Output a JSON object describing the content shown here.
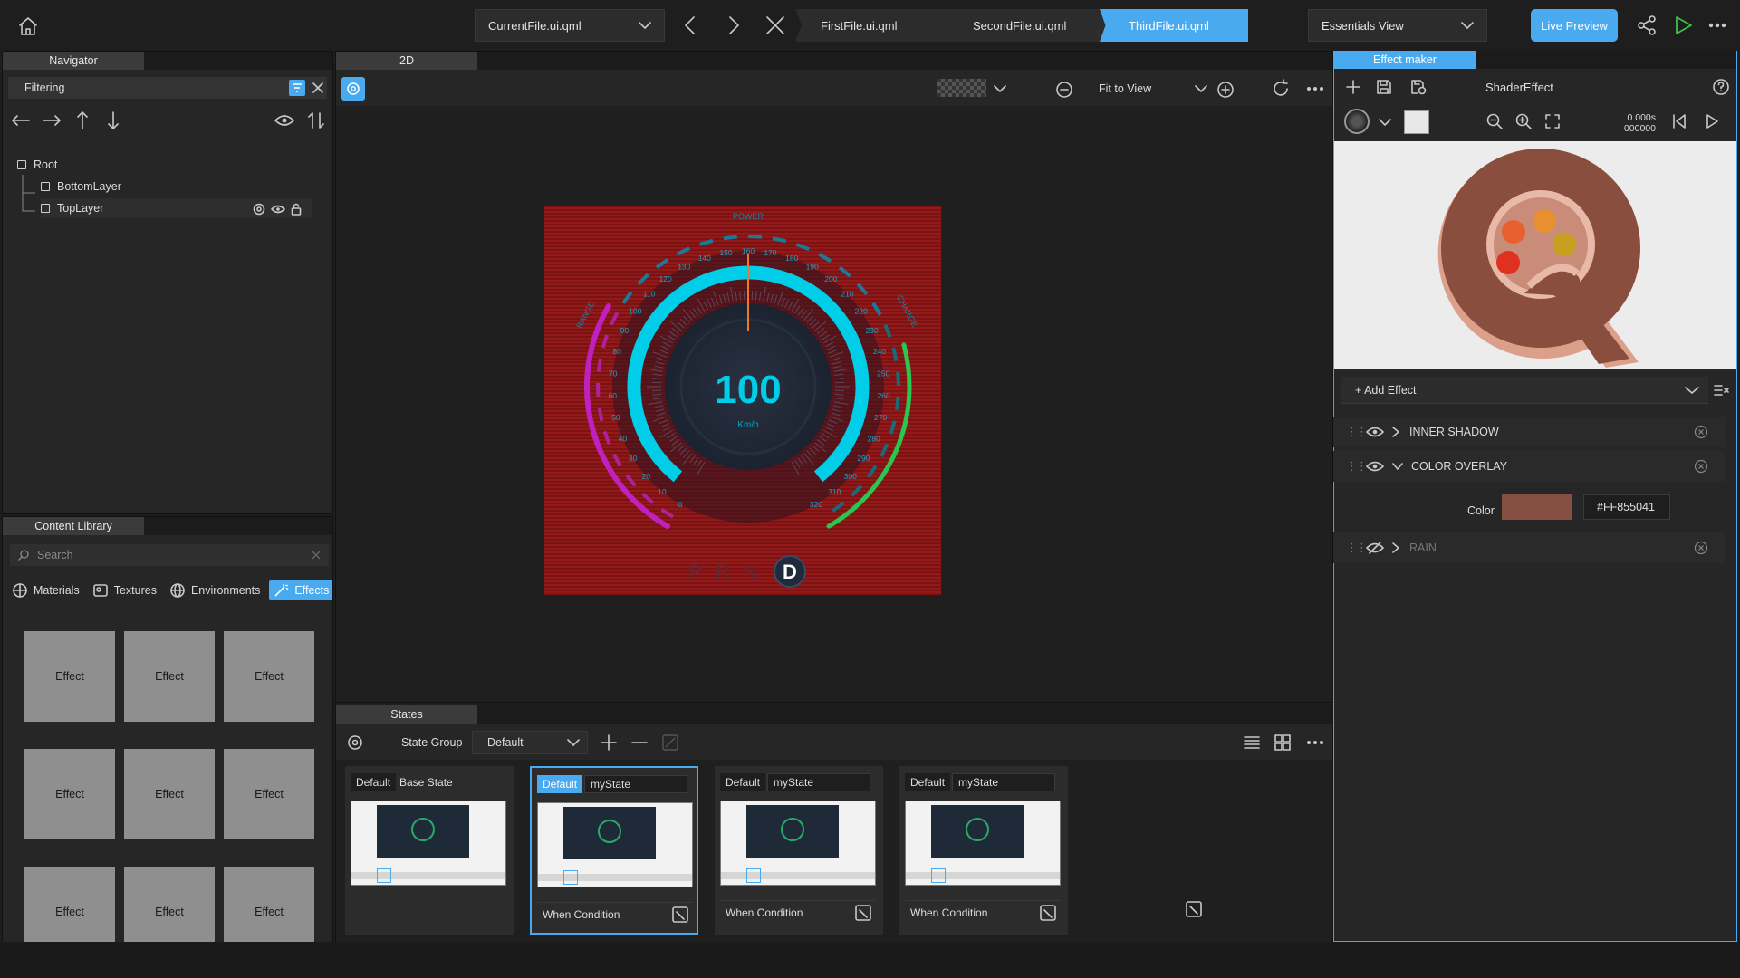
{
  "topbar": {
    "current_file": "CurrentFile.ui.qml",
    "tabs": [
      "FirstFile.ui.qml",
      "SecondFile.ui.qml",
      "ThirdFile.ui.qml"
    ],
    "active_tab": 2,
    "workspace": "Essentials View",
    "live_preview": "Live Preview"
  },
  "navigator": {
    "title": "Navigator",
    "filter_placeholder": "Filtering",
    "tree": [
      {
        "label": "Root",
        "level": 0
      },
      {
        "label": "BottomLayer",
        "level": 1
      },
      {
        "label": "TopLayer",
        "level": 1,
        "selected": true
      }
    ]
  },
  "library": {
    "title": "Content Library",
    "search_placeholder": "Search",
    "tabs": [
      {
        "label": "Materials",
        "icon": "sphere-icon"
      },
      {
        "label": "Textures",
        "icon": "image-icon"
      },
      {
        "label": "Environments",
        "icon": "globe-icon"
      },
      {
        "label": "Effects",
        "icon": "wand-icon",
        "active": true
      }
    ],
    "tiles": [
      "Effect",
      "Effect",
      "Effect",
      "Effect",
      "Effect",
      "Effect",
      "Effect",
      "Effect",
      "Effect"
    ]
  },
  "editor": {
    "tab": "2D",
    "zoom": "Fit to View"
  },
  "speedometer": {
    "speed": "100",
    "unit": "Km/h",
    "power_label": "POWER",
    "range_label": "RANGE",
    "charge_label": "CHARGE",
    "ticks": [
      "0",
      "10",
      "20",
      "30",
      "40",
      "50",
      "60",
      "70",
      "80",
      "90",
      "100",
      "110",
      "120",
      "130",
      "140",
      "150",
      "160",
      "170",
      "180",
      "190",
      "200",
      "210",
      "220",
      "230",
      "240",
      "250",
      "260",
      "270",
      "280",
      "290",
      "300",
      "310",
      "320"
    ],
    "gears": [
      "P",
      "R",
      "N",
      "D"
    ],
    "active_gear": "D"
  },
  "states": {
    "title": "States",
    "group_label": "State Group",
    "group_value": "Default",
    "cards": [
      {
        "badge": "Default",
        "name": "Base State",
        "condition": ""
      },
      {
        "badge": "Default",
        "name": "myState",
        "condition": "When Condition"
      },
      {
        "badge": "Default",
        "name": "myState",
        "condition": "When Condition"
      },
      {
        "badge": "Default",
        "name": "myState",
        "condition": "When Condition"
      }
    ]
  },
  "effect_maker": {
    "title": "Effect maker",
    "shader_name": "ShaderEffect",
    "time": "0.000s",
    "frame": "000000",
    "add_effect": "+ Add Effect",
    "effects": [
      {
        "name": "INNER SHADOW",
        "visible": true,
        "expanded": false
      },
      {
        "name": "COLOR OVERLAY",
        "visible": true,
        "expanded": true
      },
      {
        "name": "RAIN",
        "visible": false,
        "expanded": false
      }
    ],
    "color_label": "Color",
    "color_value": "#FF855041",
    "swatch": "#855041"
  },
  "colors": {
    "accent": "#4aaaf0",
    "cyan": "#00cde8",
    "magenta": "#c020c0",
    "green": "#28c850",
    "dash_bg": "#8a1414"
  }
}
